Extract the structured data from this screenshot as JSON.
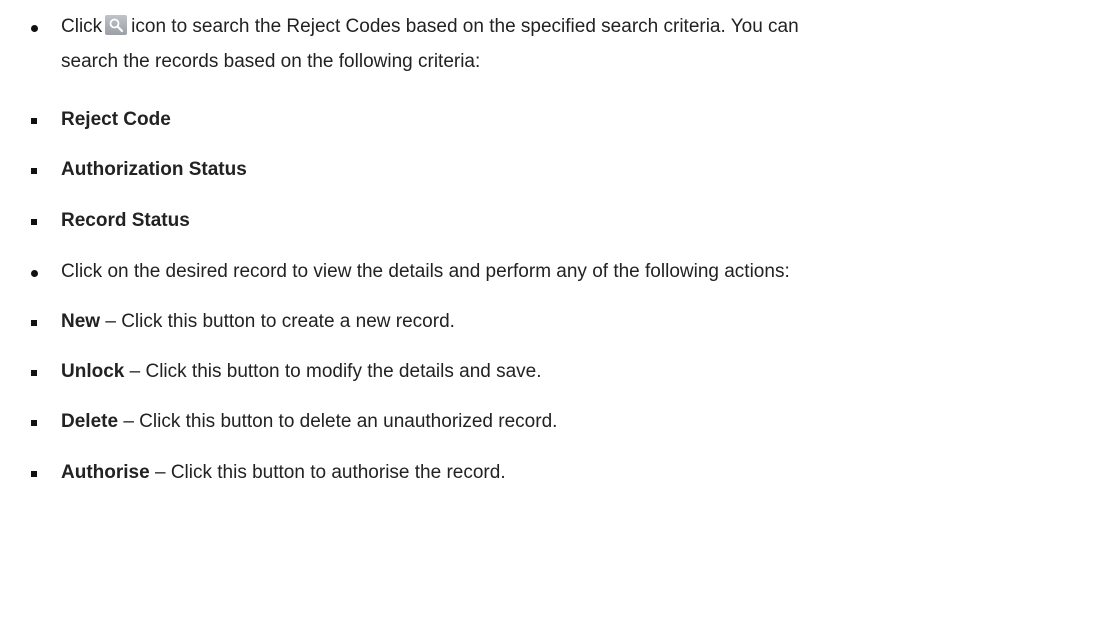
{
  "intro": {
    "prefix": "Click",
    "icon": "search-icon",
    "line1_rest": "icon to search the Reject Codes based on the specified search criteria. You can",
    "line2": "search the records based on the following criteria:"
  },
  "criteria": [
    "Reject Code",
    "Authorization Status",
    "Record Status"
  ],
  "actions_intro": "Click on the desired record to view the details and perform any of the following actions:",
  "actions": [
    {
      "name": "New",
      "desc": "– Click this button to create a new record."
    },
    {
      "name": "Unlock",
      "desc": "– Click this button to modify the details and save."
    },
    {
      "name": "Delete",
      "desc": "– Click this button to delete an unauthorized record."
    },
    {
      "name": "Authorise",
      "desc": "– Click this button to authorise the record."
    }
  ]
}
